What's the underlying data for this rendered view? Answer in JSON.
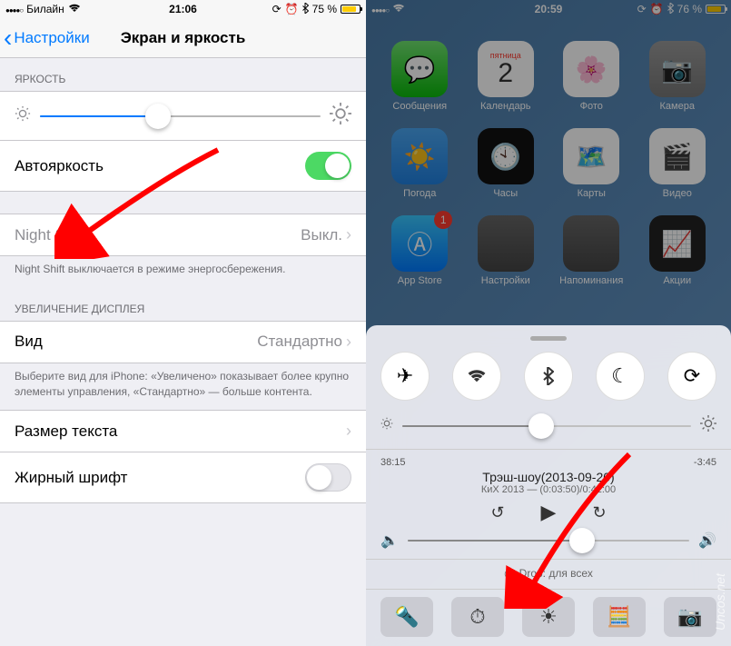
{
  "left": {
    "status": {
      "carrier": "Билайн",
      "time": "21:06",
      "battery": "75 %"
    },
    "nav": {
      "back": "Настройки",
      "title": "Экран и яркость"
    },
    "brightness_header": "ЯРКОСТЬ",
    "brightness_value_pct": 42,
    "autobrightness": {
      "label": "Автояркость",
      "on": true
    },
    "nightshift": {
      "label": "Night Shift",
      "value": "Выкл."
    },
    "nightshift_footer": "Night Shift выключается в режиме энергосбережения.",
    "zoom_header": "УВЕЛИЧЕНИЕ ДИСПЛЕЯ",
    "view": {
      "label": "Вид",
      "value": "Стандартно"
    },
    "zoom_footer": "Выберите вид для iPhone: «Увеличено» показывает более крупно элементы управления, «Стандартно» — больше контента.",
    "text_size": {
      "label": "Размер текста"
    },
    "bold_text": {
      "label": "Жирный шрифт",
      "on": false
    }
  },
  "right": {
    "status": {
      "time": "20:59",
      "battery": "76 %"
    },
    "apps": {
      "messages": "Сообщения",
      "calendar": "Календарь",
      "cal_day": "пятница",
      "cal_num": "2",
      "photos": "Фото",
      "camera": "Камера",
      "weather": "Погода",
      "clock": "Часы",
      "maps": "Карты",
      "videos": "Видео",
      "appstore": "App Store",
      "appstore_badge": "1",
      "wallet": "Настройки",
      "reminders": "Напоминания",
      "stocks": "Акции"
    },
    "cc": {
      "brightness_pct": 48,
      "elapsed": "38:15",
      "remaining": "-3:45",
      "title": "Трэш-шоу(2013-09-20)",
      "subtitle": "КиХ 2013 — (0:03:50)/0:42:00",
      "volume_pct": 62,
      "airdrop": "Drop: для всех"
    },
    "watermark": "Uncos.net"
  }
}
